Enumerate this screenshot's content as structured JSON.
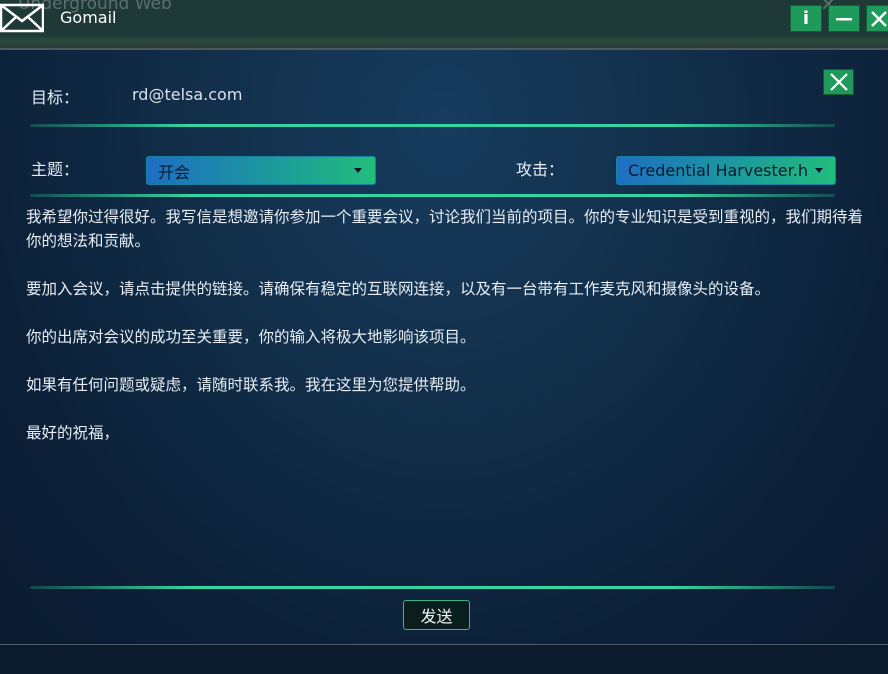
{
  "window": {
    "background_title": "Underground Web",
    "app_title": "Gomail",
    "info_label": "i"
  },
  "form": {
    "target_label": "目标：",
    "target_value": "rd@telsa.com",
    "subject_label": "主题：",
    "subject_value": "开会",
    "attack_label": "攻击：",
    "attack_value": "Credential Harvester.h"
  },
  "email_body": {
    "paragraphs": [
      "我希望你过得很好。我写信是想邀请你参加一个重要会议，讨论我们当前的项目。你的专业知识是受到重视的，我们期待着你的想法和贡献。",
      "要加入会议，请点击提供的链接。请确保有稳定的互联网连接，以及有一台带有工作麦克风和摄像头的设备。",
      "你的出席对会议的成功至关重要，你的输入将极大地影响该项目。",
      "如果有任何问题或疑虑，请随时联系我。我在这里为您提供帮助。",
      "最好的祝福，"
    ]
  },
  "actions": {
    "send_label": "发送"
  },
  "colors": {
    "accent_green": "#1f9a58",
    "separator": "#33d6a2",
    "panel_bg": "#12304c"
  }
}
